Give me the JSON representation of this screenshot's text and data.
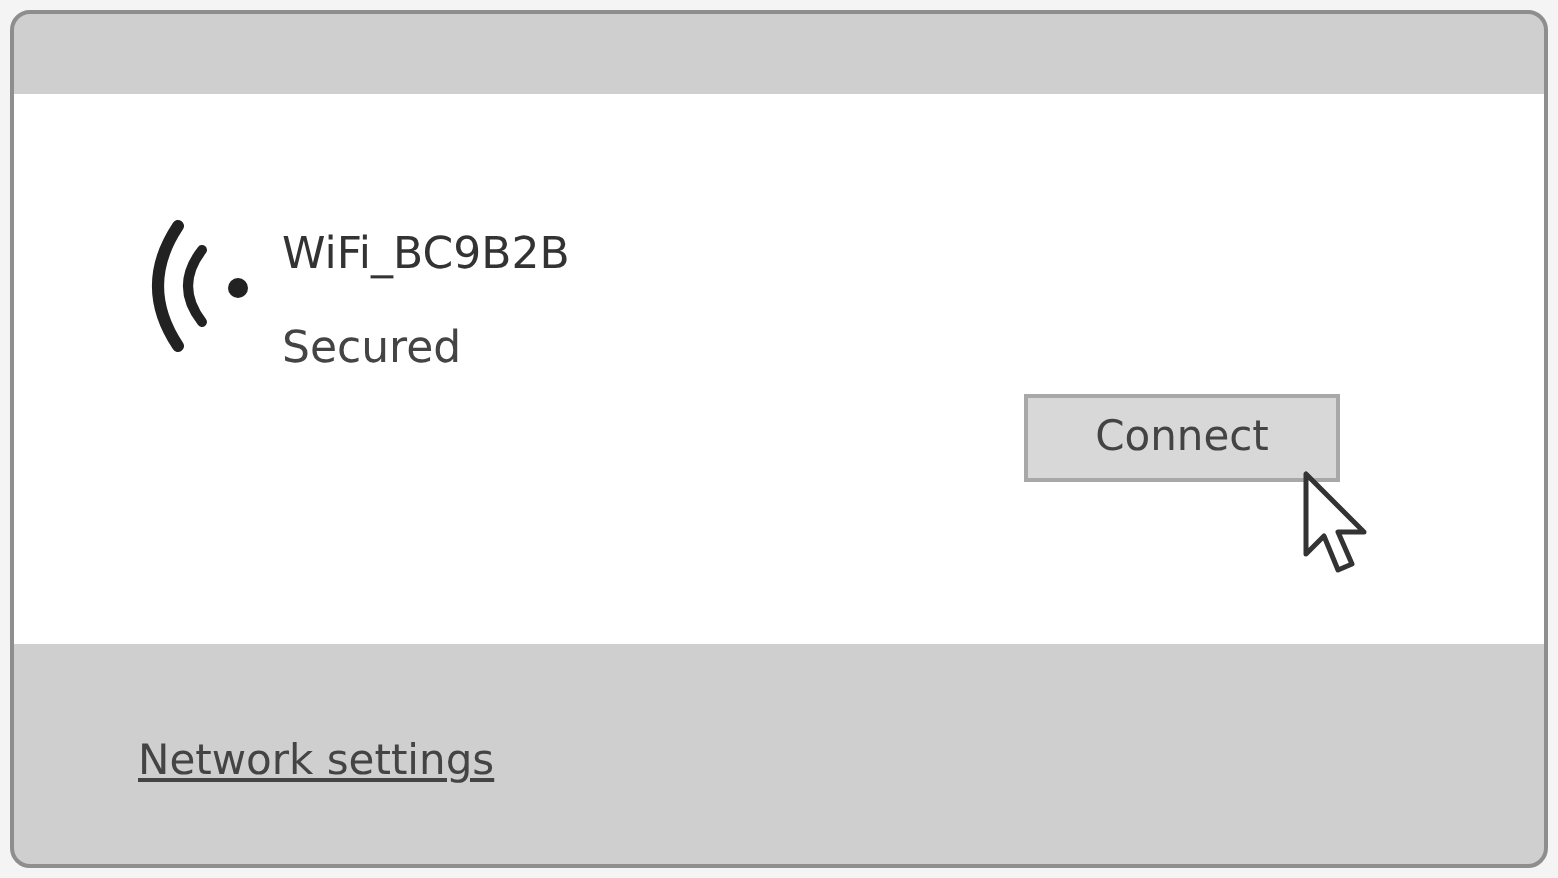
{
  "network": {
    "name": "WiFi_BC9B2B",
    "status": "Secured"
  },
  "connect_button": {
    "label": "Connect"
  },
  "footer": {
    "link": "Network settings"
  }
}
